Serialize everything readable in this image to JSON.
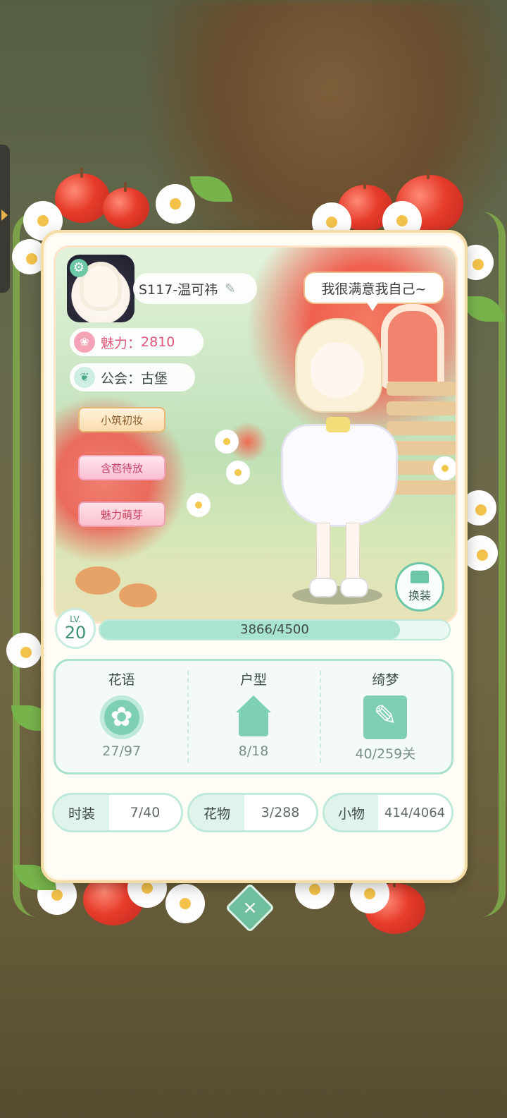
{
  "player": {
    "name": "S117-温可祎",
    "speech": "我很满意我自己~"
  },
  "stats": {
    "charm_label": "魅力：",
    "charm_value": "2810",
    "guild_label": "公会：",
    "guild_value": "古堡"
  },
  "badges": [
    "小筑初妆",
    "含苞待放",
    "魅力萌芽"
  ],
  "change_outfit_label": "换装",
  "level": {
    "lv_text": "LV.",
    "value": "20",
    "xp_text": "3866/4500",
    "progress": 0.859
  },
  "collections": [
    {
      "label": "花语",
      "value": "27/97",
      "icon": "flower-icon"
    },
    {
      "label": "户型",
      "value": "8/18",
      "icon": "house-icon"
    },
    {
      "label": "绮梦",
      "value": "40/259关",
      "icon": "book-quill-icon"
    }
  ],
  "inventory": [
    {
      "label": "时装",
      "value": "7/40"
    },
    {
      "label": "花物",
      "value": "3/288"
    },
    {
      "label": "小物",
      "value": "414/4064"
    }
  ],
  "close_label": "×",
  "colors": {
    "accent": "#6cc6a7",
    "charm": "#e0567a",
    "card_border": "#f4dca6"
  }
}
